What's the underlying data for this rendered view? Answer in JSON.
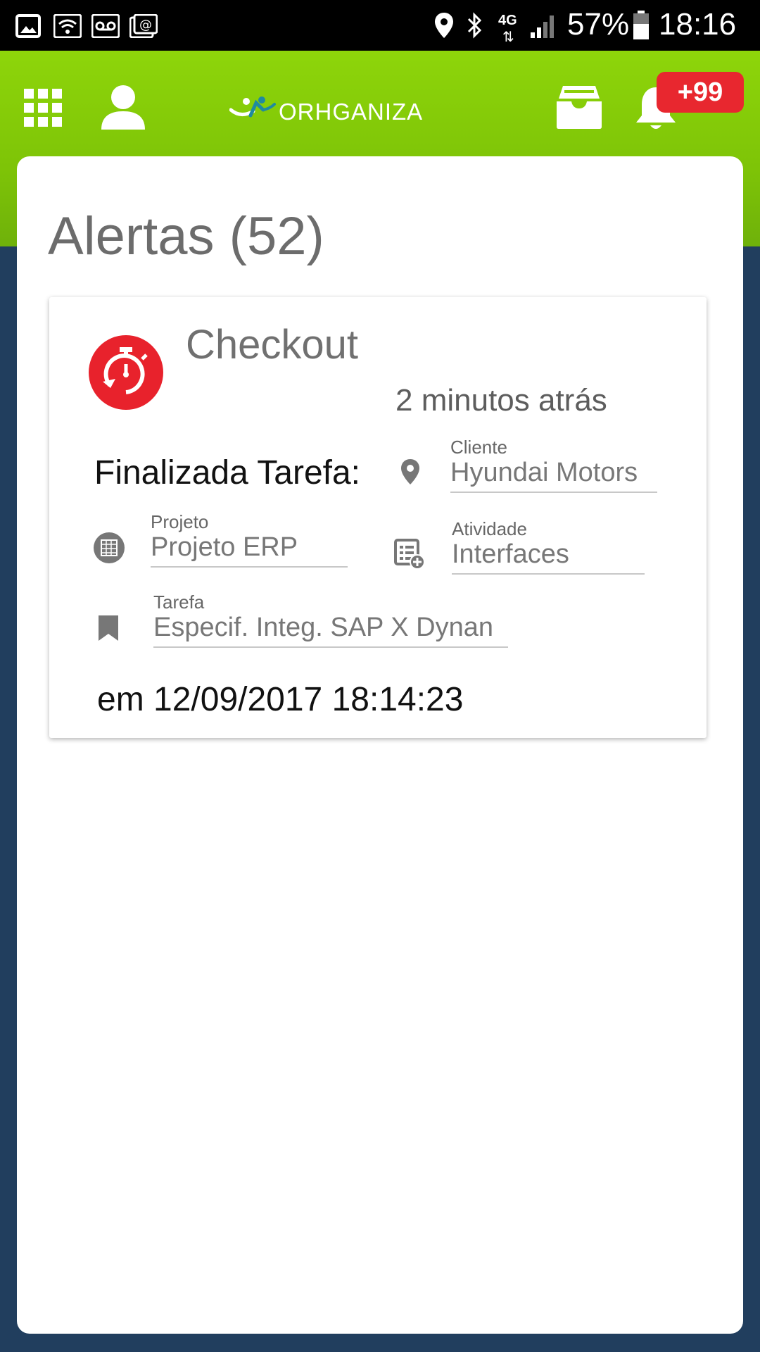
{
  "status_bar": {
    "network_label": "4G",
    "battery_percent": "57%",
    "time": "18:16"
  },
  "header": {
    "logo_text": "ORHGANIZA",
    "notification_badge": "+99"
  },
  "page": {
    "title": "Alertas (52)"
  },
  "alert": {
    "title": "Checkout",
    "time_ago": "2 minutos atrás",
    "description": "Finalizada Tarefa:",
    "fields": {
      "cliente": {
        "label": "Cliente",
        "value": "Hyundai Motors"
      },
      "projeto": {
        "label": "Projeto",
        "value": "Projeto ERP"
      },
      "atividade": {
        "label": "Atividade",
        "value": "Interfaces"
      },
      "tarefa": {
        "label": "Tarefa",
        "value": "Especif. Integ. SAP X Dynan"
      }
    },
    "date": "em 12/09/2017 18:14:23"
  },
  "colors": {
    "header_green": "#7ec407",
    "background_navy": "#213e5e",
    "alert_red": "#e8222c",
    "badge_red": "#e8272f"
  },
  "icons": {
    "gallery": "image-icon",
    "wifi": "wifi-icon",
    "voicemail": "voicemail-icon",
    "mail": "email-icon",
    "location": "location-icon",
    "bluetooth": "bluetooth-icon",
    "signal": "signal-icon",
    "battery": "battery-icon",
    "apps": "apps-grid-icon",
    "profile": "user-icon",
    "inbox": "inbox-icon",
    "notifications": "bell-icon",
    "alert": "stopwatch-icon",
    "cliente": "map-pin-icon",
    "projeto": "project-icon",
    "atividade": "activity-list-icon",
    "tarefa": "bookmark-icon"
  }
}
